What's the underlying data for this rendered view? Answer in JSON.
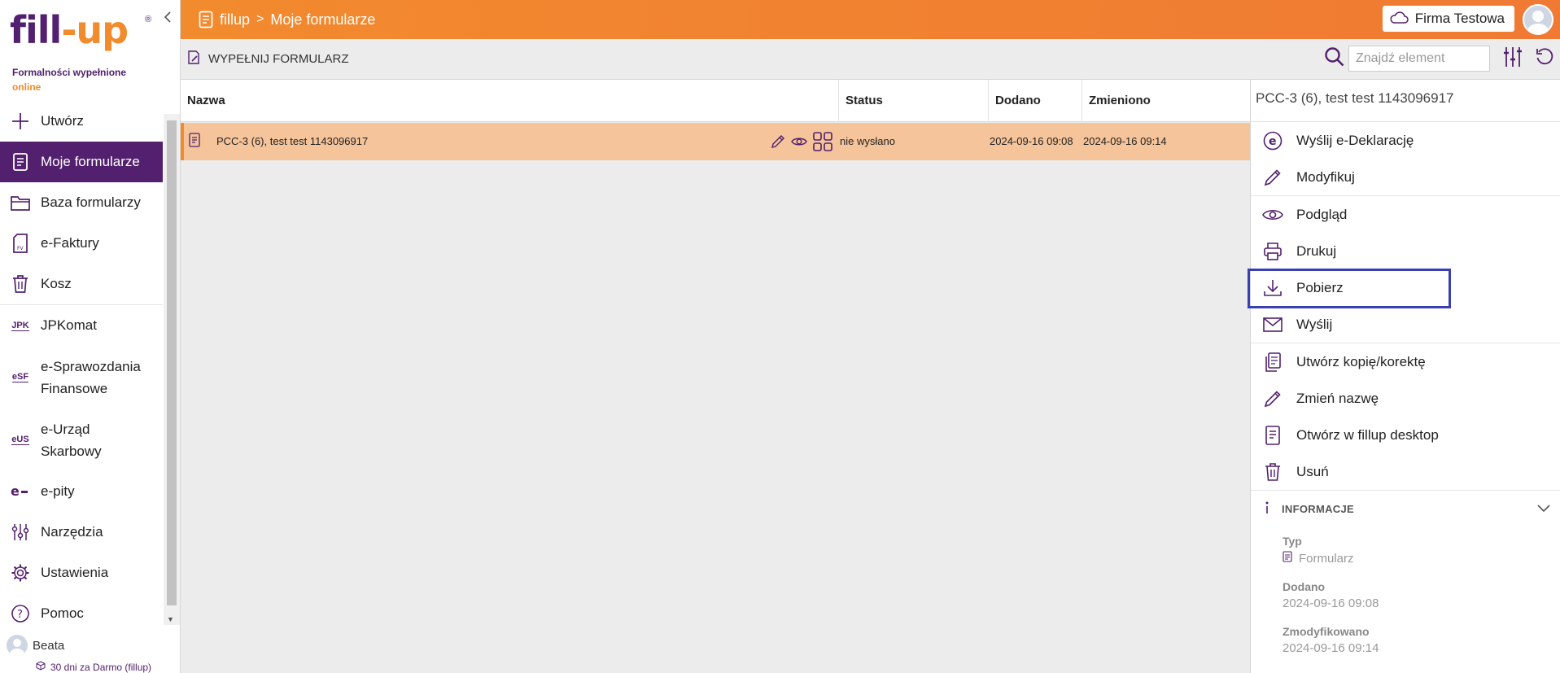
{
  "brand": {
    "logo_fill": "fill",
    "logo_dash": "-",
    "logo_up": "up",
    "logo_reg": "®",
    "tagline_line1": "Formalności wypełnione",
    "tagline_line2": "online",
    "primary_color": "#52206e",
    "accent_color": "#f18b2c"
  },
  "sidebar": {
    "collapse_icon": "chevron-left-icon",
    "items": [
      {
        "label": "Utwórz",
        "icon": "plus-icon"
      },
      {
        "label": "Moje formularze",
        "icon": "document-icon",
        "active": true
      },
      {
        "label": "Baza formularzy",
        "icon": "folder-icon"
      },
      {
        "label": "e-Faktury",
        "icon": "invoice-icon"
      },
      {
        "label": "Kosz",
        "icon": "trash-icon"
      },
      {
        "label": "JPKomat",
        "icon": "jpk-icon",
        "icon_text": "JPK"
      },
      {
        "label": "e-Sprawozdania Finansowe",
        "line1": "e-Sprawozdania",
        "line2": "Finansowe",
        "icon": "esf-icon",
        "icon_text": "eSF"
      },
      {
        "label": "e-Urząd Skarbowy",
        "line1": "e-Urząd",
        "line2": "Skarbowy",
        "icon": "eus-icon",
        "icon_text": "eUS"
      },
      {
        "label": "e-pity",
        "icon": "epity-icon"
      },
      {
        "label": "Narzędzia",
        "icon": "tools-icon"
      },
      {
        "label": "Ustawienia",
        "icon": "gear-icon"
      },
      {
        "label": "Pomoc",
        "icon": "help-icon"
      }
    ],
    "user": {
      "name": "Beata",
      "plan": "30 dni za Darmo (fillup)"
    }
  },
  "header": {
    "crumb_root": "fillup",
    "crumb_sep": ">",
    "crumb_current": "Moje formularze",
    "company": "Firma Testowa"
  },
  "toolbar": {
    "fill_button": "WYPEŁNIJ FORMULARZ",
    "search_placeholder": "Znajdź element"
  },
  "table": {
    "columns": [
      "Nazwa",
      "Status",
      "Dodano",
      "Zmieniono"
    ],
    "rows": [
      {
        "name": "PCC-3 (6), test test 1143096917",
        "status": "nie wysłano",
        "added": "2024-09-16 09:08",
        "modified": "2024-09-16 09:14"
      }
    ]
  },
  "panel": {
    "title": "PCC-3 (6), test test 1143096917",
    "actions": [
      {
        "label": "Wyślij e-Deklarację",
        "icon": "edeclaration-icon"
      },
      {
        "label": "Modyfikuj",
        "icon": "pencil-icon"
      },
      {
        "label": "Podgląd",
        "icon": "eye-icon"
      },
      {
        "label": "Drukuj",
        "icon": "printer-icon"
      },
      {
        "label": "Pobierz",
        "icon": "download-icon"
      },
      {
        "label": "Wyślij",
        "icon": "envelope-icon"
      },
      {
        "label": "Utwórz kopię/korektę",
        "icon": "copy-icon"
      },
      {
        "label": "Zmień nazwę",
        "icon": "pencil-icon"
      },
      {
        "label": "Otwórz w fillup desktop",
        "icon": "document-icon"
      },
      {
        "label": "Usuń",
        "icon": "trash-icon"
      }
    ],
    "info": {
      "heading": "INFORMACJE",
      "type_label": "Typ",
      "type_value": "Formularz",
      "added_label": "Dodano",
      "added_value": "2024-09-16 09:08",
      "modified_label": "Zmodyfikowano",
      "modified_value": "2024-09-16 09:14"
    }
  }
}
